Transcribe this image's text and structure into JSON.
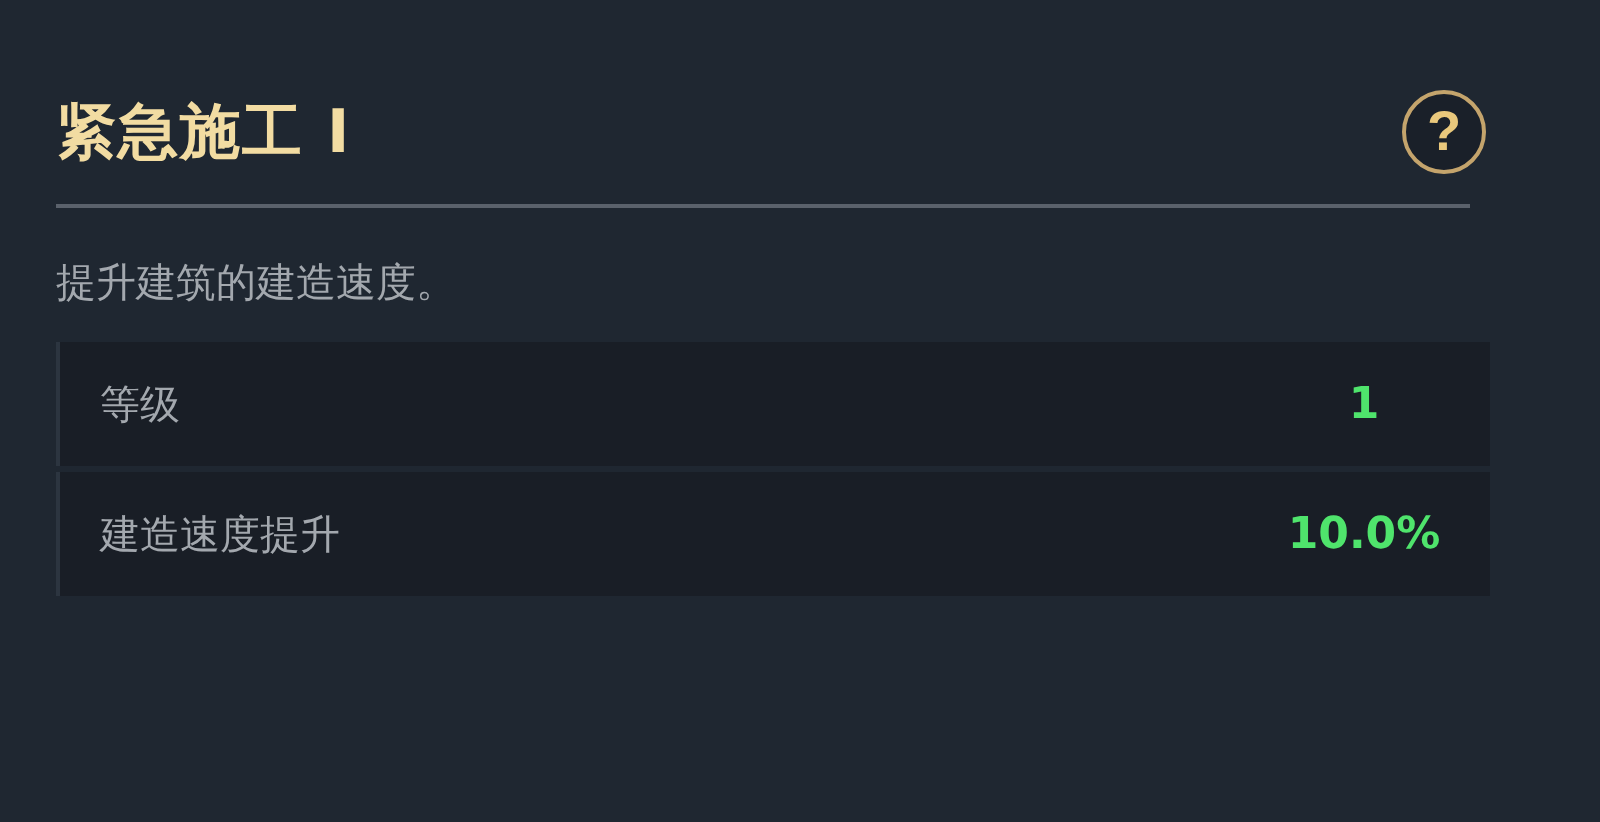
{
  "panel": {
    "title": "紧急施工 I",
    "help_icon": "?",
    "description": "提升建筑的建造速度。"
  },
  "stats": [
    {
      "label": "等级",
      "value": "1"
    },
    {
      "label": "建造速度提升",
      "value": "10.0%"
    }
  ]
}
